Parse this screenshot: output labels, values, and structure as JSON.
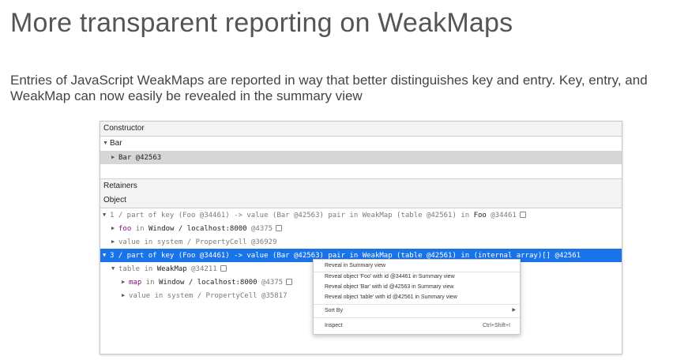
{
  "slide": {
    "title": "More transparent reporting on WeakMaps",
    "description": "Entries of JavaScript WeakMaps are reported in way that better distinguishes key and entry. Key, entry, and WeakMap can now easily be revealed in the summary view"
  },
  "panel": {
    "constructor_header": "Constructor",
    "bar_row": "Bar",
    "bar_instance": "Bar @42563",
    "retainers_header": "Retainers",
    "object_header": "Object",
    "rows": {
      "r1": {
        "gray1": "1 / part of key (Foo @34461) -> value (Bar @42563) pair in WeakMap (table @42561) in",
        "black1": "Foo",
        "gray2": "@34461"
      },
      "r2": {
        "purple": "foo",
        "gray1": "in",
        "black1": "Window / localhost:8000",
        "gray2": "@4375"
      },
      "r3": {
        "gray1": "value in system / PropertyCell @36929"
      },
      "r4": {
        "text": "3 / part of key (Foo @34461) -> value (Bar @42563) pair in WeakMap (table @42561) in (internal array)[] @42561"
      },
      "r5": {
        "gray1": "table in",
        "black1": "WeakMap",
        "gray2": "@34211"
      },
      "r6": {
        "purple": "map",
        "gray1": "in",
        "black1": "Window / localhost:8000",
        "gray2": "@4375"
      },
      "r7": {
        "gray1": "value in system / PropertyCell @35817"
      }
    }
  },
  "context_menu": {
    "reveal_summary": "Reveal in Summary view",
    "reveal_foo": "Reveal object 'Foo' with id @34461 in Summary view",
    "reveal_bar": "Reveal object 'Bar' with id @42563 in Summary view",
    "reveal_table": "Reveal object 'table' with id @42561 in Summary view",
    "sort_by": "Sort By",
    "inspect": "Inspect",
    "inspect_shortcut": "Ctrl+Shift+I"
  },
  "icons": {
    "expanded": "triangle-down-icon",
    "collapsed": "triangle-right-icon",
    "store_as_global": "store-as-global-icon",
    "submenu": "submenu-arrow-icon"
  },
  "colors": {
    "selection": "#1a73e8",
    "property_name": "#881280",
    "shaded_row": "#d6d6d6"
  }
}
